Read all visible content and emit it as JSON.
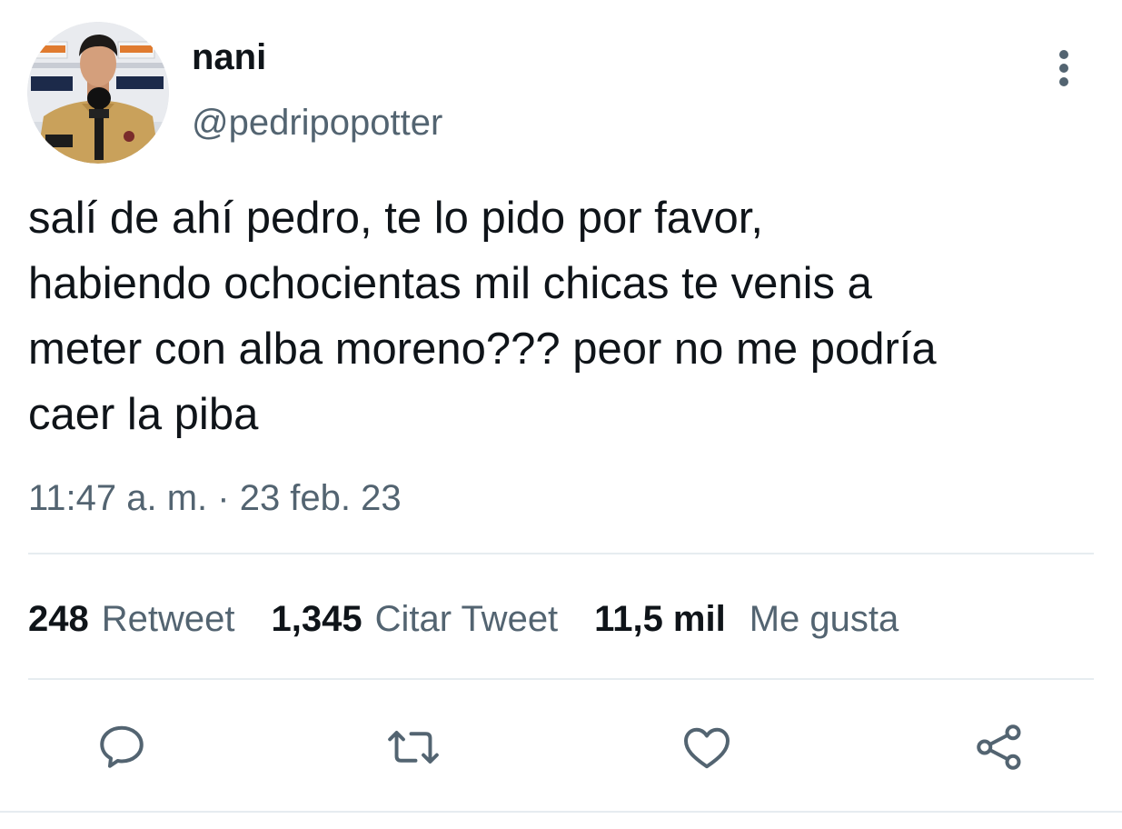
{
  "user": {
    "display_name": "nani",
    "handle": "@pedripopotter",
    "avatar_icon": "profile-photo"
  },
  "tweet": {
    "text": "salí de ahí pedro, te lo pido por favor,\nhabiendo ochocientas mil chicas te venis a\nmeter con alba moreno??? peor no me podría\ncaer la piba",
    "timestamp": "11:47 a. m. · 23 feb. 23"
  },
  "stats": {
    "retweets_count": "248",
    "retweets_label": "Retweet",
    "quotes_count": "1,345",
    "quotes_label": "Citar Tweet",
    "likes_count": "11,5 mil",
    "likes_label": "Me gusta"
  },
  "actions": [
    {
      "name": "reply",
      "icon": "comment-icon"
    },
    {
      "name": "retweet",
      "icon": "retweet-icon"
    },
    {
      "name": "like",
      "icon": "heart-icon"
    },
    {
      "name": "share",
      "icon": "share-icon"
    }
  ],
  "colors": {
    "text_primary": "#0f1419",
    "text_secondary": "#536471",
    "divider": "#e6ecf0"
  }
}
